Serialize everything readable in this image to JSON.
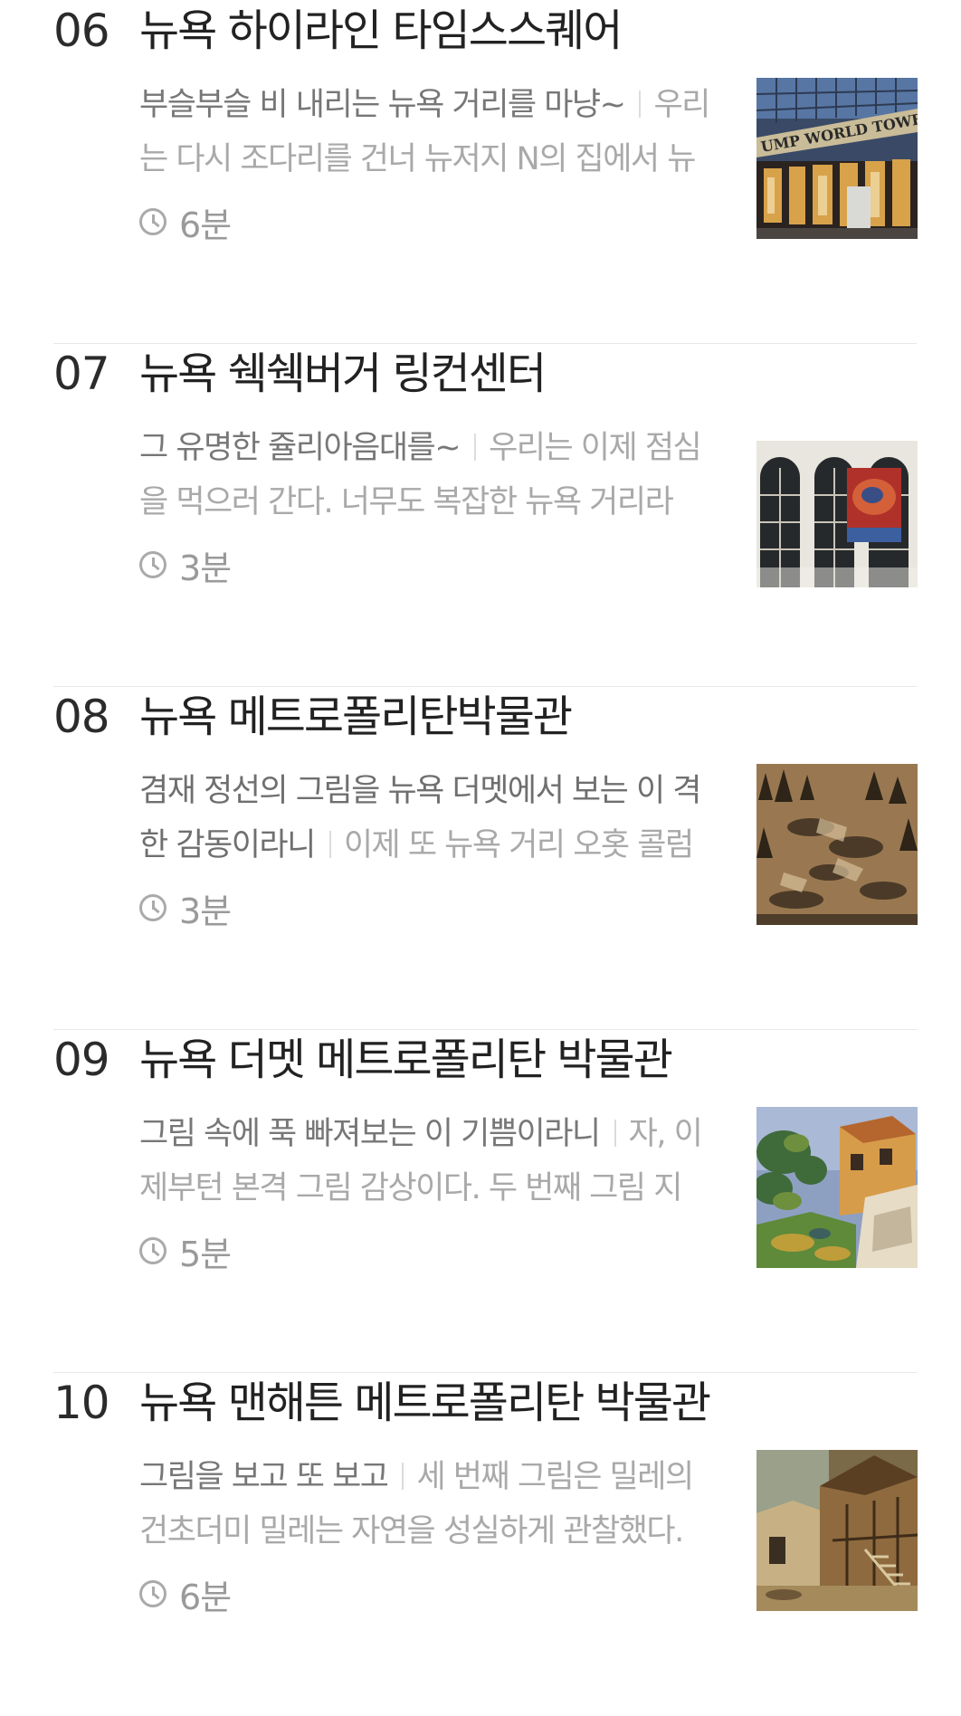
{
  "articles": [
    {
      "number": "06",
      "title": "뉴욕 하이라인 타임스스퀘어",
      "lead": "부슬부슬 비 내리는 뉴욕 거리를 마냥~",
      "excerpt": "우리는 다시 조다리를 건너 뉴저지 N의 집에서 뉴",
      "read_time": "6분",
      "thumbnail_text": "UMP WORLD TOWE"
    },
    {
      "number": "07",
      "title": "뉴욕 쉑쉑버거 링컨센터",
      "lead": "그 유명한 쥴리아음대를~",
      "excerpt": "우리는 이제 점심을 먹으러 간다. 너무도 복잡한 뉴욕 거리라",
      "read_time": "3분"
    },
    {
      "number": "08",
      "title": "뉴욕 메트로폴리탄박물관",
      "lead": "겸재 정선의 그림을 뉴욕 더멧에서 보는 이 격한 감동이라니",
      "excerpt": "이제 또 뉴욕 거리 오홋 콜럼",
      "read_time": "3분"
    },
    {
      "number": "09",
      "title": "뉴욕 더멧 메트로폴리탄 박물관",
      "lead": "그림 속에 푹 빠져보는 이 기쁨이라니",
      "excerpt": "자, 이제부턴 본격 그림 감상이다. 두 번째 그림 지",
      "read_time": "5분"
    },
    {
      "number": "10",
      "title": "뉴욕 맨해튼 메트로폴리탄 박물관",
      "lead": "그림을 보고 또 보고",
      "excerpt": "세 번째 그림은 밀레의 건초더미 밀레는 자연을 성실하게 관찰했다.",
      "read_time": "6분"
    }
  ],
  "icons": {
    "read_time": "clock-icon"
  },
  "colors": {
    "title": "#222222",
    "lead": "#777777",
    "excerpt": "#a9a9a9",
    "divider": "#e8e8e8"
  }
}
